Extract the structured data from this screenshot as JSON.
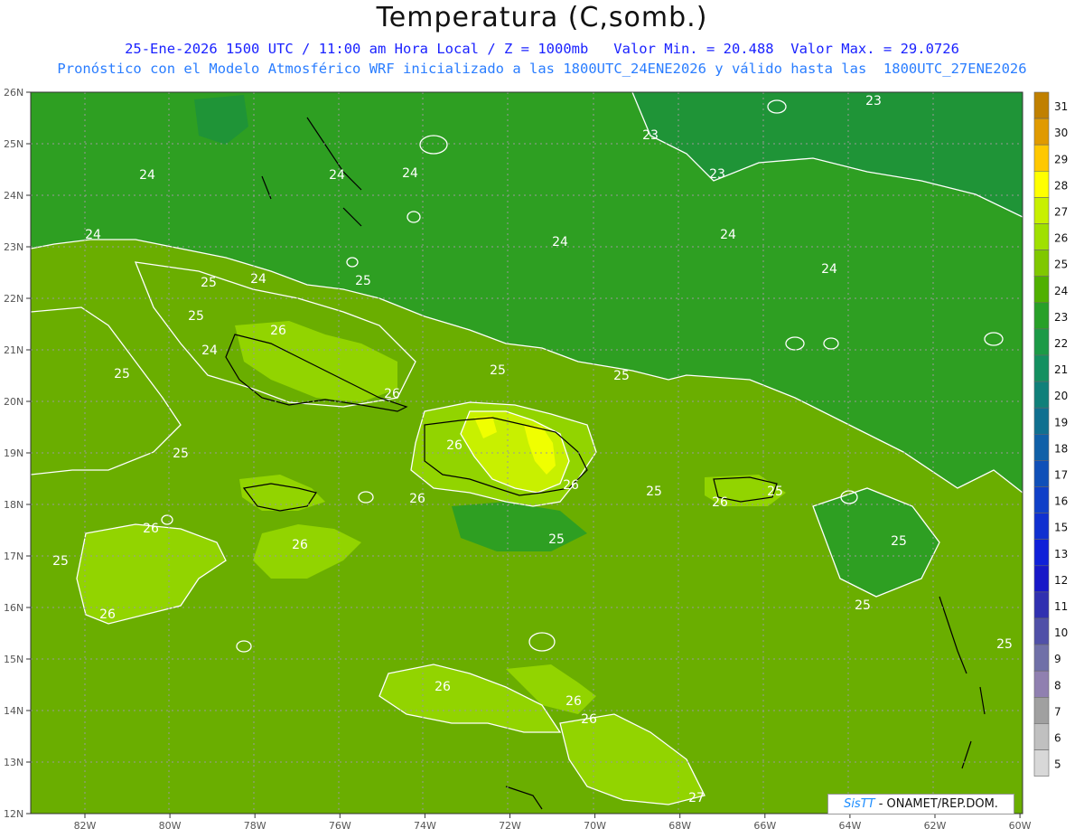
{
  "header": {
    "title": "Temperatura (C,somb.)",
    "line1": "25-Ene-2026 1500 UTC / 11:00 am Hora Local / Z = 1000mb   Valor Min. = 20.488  Valor Max. = 29.0726",
    "line2": "Pronóstico con el Modelo Atmosférico WRF inicializado a las 1800UTC_24ENE2026 y válido hasta las  1800UTC_27ENE2026"
  },
  "axes": {
    "lat_labels": [
      "26N",
      "25N",
      "24N",
      "23N",
      "22N",
      "21N",
      "20N",
      "19N",
      "18N",
      "17N",
      "16N",
      "15N",
      "14N",
      "13N",
      "12N"
    ],
    "lon_labels": [
      "82W",
      "80W",
      "78W",
      "76W",
      "74W",
      "72W",
      "70W",
      "68W",
      "66W",
      "64W",
      "62W",
      "60W"
    ]
  },
  "contour_labels": [
    {
      "text": "24"
    },
    {
      "text": "24"
    },
    {
      "text": "24"
    },
    {
      "text": "24"
    },
    {
      "text": "24"
    },
    {
      "text": "24"
    },
    {
      "text": "24"
    },
    {
      "text": "24"
    },
    {
      "text": "24"
    },
    {
      "text": "23"
    },
    {
      "text": "23"
    },
    {
      "text": "23"
    },
    {
      "text": "25"
    },
    {
      "text": "25"
    },
    {
      "text": "25"
    },
    {
      "text": "25"
    },
    {
      "text": "25"
    },
    {
      "text": "25"
    },
    {
      "text": "25"
    },
    {
      "text": "25"
    },
    {
      "text": "25"
    },
    {
      "text": "25"
    },
    {
      "text": "25"
    },
    {
      "text": "25"
    },
    {
      "text": "25"
    },
    {
      "text": "25"
    },
    {
      "text": "26"
    },
    {
      "text": "26"
    },
    {
      "text": "26"
    },
    {
      "text": "26"
    },
    {
      "text": "26"
    },
    {
      "text": "26"
    },
    {
      "text": "26"
    },
    {
      "text": "26"
    },
    {
      "text": "26"
    },
    {
      "text": "26"
    },
    {
      "text": "26"
    },
    {
      "text": "26"
    },
    {
      "text": "27"
    }
  ],
  "colorbar": {
    "levels": [
      "31",
      "30",
      "29",
      "28",
      "27",
      "26",
      "25",
      "24",
      "23",
      "22",
      "21",
      "20",
      "19",
      "18",
      "17",
      "16",
      "15",
      "13",
      "12",
      "11",
      "10",
      "9",
      "8",
      "7",
      "6",
      "5"
    ],
    "colors": [
      "#c08000",
      "#e09a00",
      "#ffc800",
      "#ffff00",
      "#c8f000",
      "#a0e000",
      "#80c800",
      "#50b000",
      "#28a028",
      "#1c9a46",
      "#149060",
      "#10807a",
      "#107090",
      "#1060a8",
      "#1050b8",
      "#1040c8",
      "#1030d0",
      "#1020d8",
      "#1818c8",
      "#3030b0",
      "#5050a8",
      "#7070a8",
      "#9080b0",
      "#a0a0a0",
      "#c0c0c0",
      "#d8d8d8"
    ]
  },
  "credit": {
    "logo": "SisTT",
    "text": " - ONAMET/REP.DOM."
  }
}
